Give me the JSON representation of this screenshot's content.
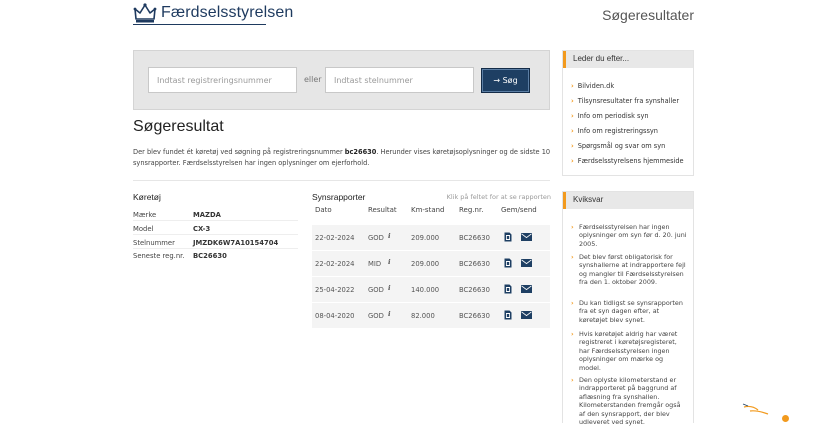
{
  "header": {
    "logo_text": "Færdselsstyrelsen",
    "page_title": "Søgeresultater"
  },
  "search": {
    "reg_placeholder": "Indtast registreringsnummer",
    "or_label": "eller",
    "stel_placeholder": "Indtast stelnummer",
    "button_label": "→ Søg"
  },
  "result": {
    "title": "Søgeresultat",
    "intro_before": "Der blev fundet ét køretøj ved søgning på registreringsnummer ",
    "intro_reg": "bc26630",
    "intro_after": ". Herunder vises køretøjsoplysninger og de sidste 10 synsrapporter. Færdselsstyrelsen har ingen oplysninger om ejerforhold."
  },
  "vehicle": {
    "heading": "Køretøj",
    "fields": [
      {
        "label": "Mærke",
        "value": "MAZDA"
      },
      {
        "label": "Model",
        "value": "CX-3"
      },
      {
        "label": "Stelnummer",
        "value": "JMZDK6W7A10154704"
      },
      {
        "label": "Seneste reg.nr.",
        "value": "BC26630"
      }
    ]
  },
  "reports": {
    "heading": "Synsrapporter",
    "hint": "Klik på feltet for at se rapporten",
    "columns": [
      "Dato",
      "Resultat",
      "Km-stand",
      "Reg.nr.",
      "Gem/send"
    ],
    "rows": [
      {
        "date": "22-02-2024",
        "result": "GOD",
        "km": "209.000",
        "reg": "BC26630"
      },
      {
        "date": "22-02-2024",
        "result": "MID",
        "km": "209.000",
        "reg": "BC26630"
      },
      {
        "date": "25-04-2022",
        "result": "GOD",
        "km": "140.000",
        "reg": "BC26630"
      },
      {
        "date": "08-04-2020",
        "result": "GOD",
        "km": "82.000",
        "reg": "BC26630"
      }
    ]
  },
  "sidebar": {
    "leder_heading": "Leder du efter...",
    "links": [
      "Bilviden.dk",
      "Tilsynsresultater fra synshaller",
      "Info om periodisk syn",
      "Info om registreringssyn",
      "Spørgsmål og svar om syn",
      "Færdselsstyrelsens hjemmeside"
    ],
    "kviksvar_heading": "Kviksvar",
    "kviksvar": [
      "Færdselsstyrelsen har ingen oplysninger om syn før d. 20. juni 2005.",
      "Det blev først obligatorisk for synshallerne at indrapportere fejl og mangler til Færdselsstyrelsen fra den 1. oktober 2009.",
      "Du kan tidligst se synsrapporten fra et syn dagen efter, at køretøjet blev synet.",
      "Hvis køretøjet aldrig har været registreret i køretøjsregisteret, har Færdselsstyrelsen ingen oplysninger om mærke og model.",
      "Den oplyste kilometerstand er indrapporteret på baggrund af aflæsning fra synshallen. Kilometerstanden fremgår også af den synsrapport, der blev udleveret ved synet."
    ]
  },
  "colors": {
    "brand": "#1e3f63",
    "accent": "#f29a1e"
  },
  "icons": {
    "logo": "crown-icon",
    "info": "info-icon",
    "save": "pdf-icon",
    "send": "mail-icon"
  }
}
